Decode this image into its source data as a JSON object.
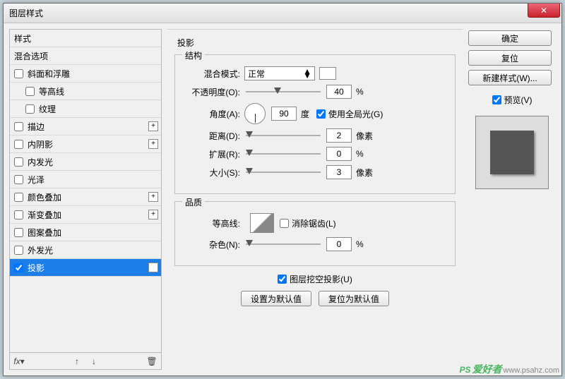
{
  "title": "图层样式",
  "left": {
    "header1": "样式",
    "header2": "混合选项",
    "items": [
      {
        "label": "斜面和浮雕",
        "checked": false,
        "plus": false
      },
      {
        "label": "等高线",
        "checked": false,
        "plus": false,
        "indent": true
      },
      {
        "label": "纹理",
        "checked": false,
        "plus": false,
        "indent": true
      },
      {
        "label": "描边",
        "checked": false,
        "plus": true
      },
      {
        "label": "内阴影",
        "checked": false,
        "plus": true
      },
      {
        "label": "内发光",
        "checked": false,
        "plus": false
      },
      {
        "label": "光泽",
        "checked": false,
        "plus": false
      },
      {
        "label": "颜色叠加",
        "checked": false,
        "plus": true
      },
      {
        "label": "渐变叠加",
        "checked": false,
        "plus": true
      },
      {
        "label": "图案叠加",
        "checked": false,
        "plus": false
      },
      {
        "label": "外发光",
        "checked": false,
        "plus": false
      },
      {
        "label": "投影",
        "checked": true,
        "plus": true,
        "selected": true
      }
    ]
  },
  "center": {
    "title": "投影",
    "group1": "结构",
    "blend_mode_label": "混合模式:",
    "blend_mode_value": "正常",
    "opacity_label": "不透明度(O):",
    "opacity_value": "40",
    "opacity_unit": "%",
    "angle_label": "角度(A):",
    "angle_value": "90",
    "angle_unit": "度",
    "global_light": "使用全局光(G)",
    "distance_label": "距离(D):",
    "distance_value": "2",
    "distance_unit": "像素",
    "spread_label": "扩展(R):",
    "spread_value": "0",
    "spread_unit": "%",
    "size_label": "大小(S):",
    "size_value": "3",
    "size_unit": "像素",
    "group2": "品质",
    "contour_label": "等高线:",
    "antialias": "消除锯齿(L)",
    "noise_label": "杂色(N):",
    "noise_value": "0",
    "noise_unit": "%",
    "knockout": "图层挖空投影(U)",
    "btn_default": "设置为默认值",
    "btn_reset": "复位为默认值"
  },
  "right": {
    "ok": "确定",
    "cancel": "复位",
    "new_style": "新建样式(W)...",
    "preview": "预览(V)"
  },
  "watermark": {
    "brand": "PS",
    "cn": "爱好者",
    "url": "www.psahz.com"
  }
}
